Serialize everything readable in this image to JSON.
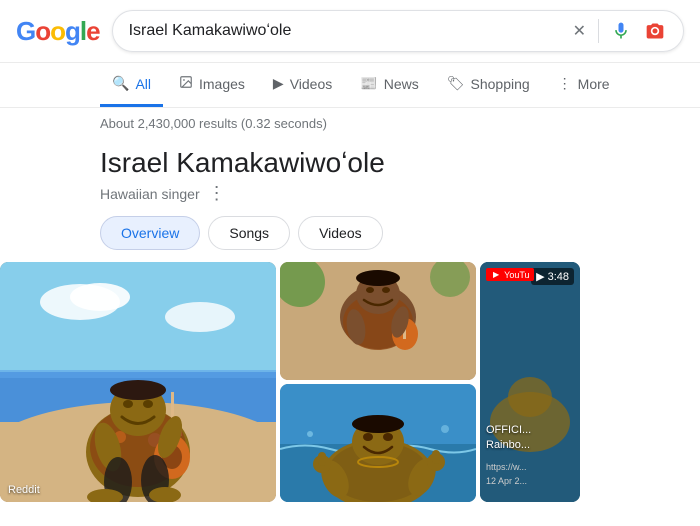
{
  "header": {
    "logo_letters": [
      {
        "char": "G",
        "color": "g-blue"
      },
      {
        "char": "o",
        "color": "g-red"
      },
      {
        "char": "o",
        "color": "g-yellow"
      },
      {
        "char": "g",
        "color": "g-blue"
      },
      {
        "char": "l",
        "color": "g-green"
      },
      {
        "char": "e",
        "color": "g-red"
      }
    ],
    "search_query": "Israel Kamakawiwoʻole",
    "clear_icon": "✕",
    "mic_icon": "🎤",
    "camera_icon": "📷"
  },
  "nav": {
    "tabs": [
      {
        "id": "all",
        "label": "All",
        "icon": "🔍",
        "active": true
      },
      {
        "id": "images",
        "label": "Images",
        "icon": "🖼"
      },
      {
        "id": "videos",
        "label": "Videos",
        "icon": "▶"
      },
      {
        "id": "news",
        "label": "News",
        "icon": "📰"
      },
      {
        "id": "shopping",
        "label": "Shopping",
        "icon": "🏷"
      },
      {
        "id": "more",
        "label": "More",
        "icon": "⋮"
      }
    ]
  },
  "results_info": {
    "text": "About 2,430,000 results (0.32 seconds)"
  },
  "entity": {
    "title": "Israel Kamakawiwoʻole",
    "subtitle": "Hawaiian singer",
    "tabs": [
      {
        "label": "Overview",
        "active": true
      },
      {
        "label": "Songs",
        "active": false
      },
      {
        "label": "Videos",
        "active": false
      }
    ]
  },
  "images": {
    "main": {
      "label": "Reddit",
      "alt": "Israel Kamakawiwoole playing guitar on beach"
    },
    "top_right": {
      "alt": "Israel Kamakawiwoole playing ukulele"
    },
    "bottom_right": {
      "alt": "Israel Kamakawiwoole in water"
    },
    "video": {
      "duration": "▶ 3:48",
      "channel": "YouTu",
      "title": "OFFICI...\nRainbo...",
      "url": "https://w...",
      "date": "12 Apr 2..."
    }
  },
  "colors": {
    "blue": "#1a73e8",
    "text_primary": "#202124",
    "text_secondary": "#70757a",
    "border": "#dadce0"
  }
}
